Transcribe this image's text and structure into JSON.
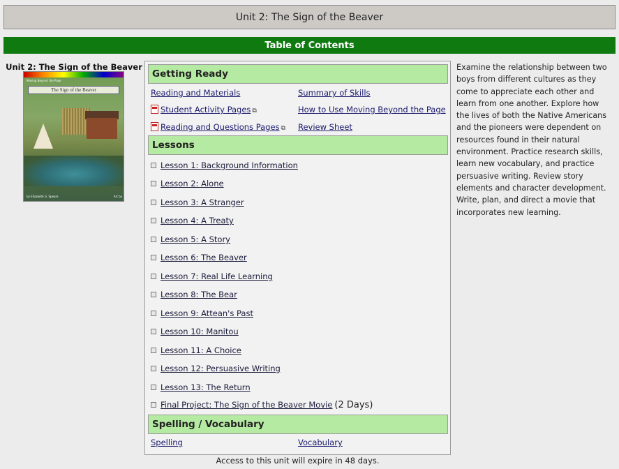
{
  "header": {
    "unit_title": "Unit 2: The Sign of the Beaver"
  },
  "toc": {
    "title": "Table of Contents"
  },
  "sidebar": {
    "title": "Unit 2: The Sign of the Beaver",
    "cover": {
      "top_left": "Moving Beyond the Page",
      "top_right": "Language Arts",
      "title": "The Sign of the Beaver",
      "bottom_left": "by Elizabeth G. Speare",
      "bottom_right": "Art by"
    }
  },
  "getting_ready": {
    "heading": "Getting Ready",
    "links": {
      "reading_materials": "Reading and Materials",
      "summary_skills": "Summary of Skills",
      "student_activity": "Student Activity Pages",
      "how_to_use": "How to Use Moving Beyond the Page",
      "reading_questions": "Reading and Questions Pages",
      "review_sheet": "Review Sheet"
    }
  },
  "lessons": {
    "heading": "Lessons",
    "items": [
      "Lesson 1: Background Information",
      "Lesson 2: Alone",
      "Lesson 3: A Stranger",
      "Lesson 4: A Treaty",
      "Lesson 5: A Story",
      "Lesson 6: The Beaver",
      "Lesson 7: Real Life Learning",
      "Lesson 8: The Bear",
      "Lesson 9: Attean's Past",
      "Lesson 10: Manitou",
      "Lesson 11: A Choice",
      "Lesson 12: Persuasive Writing",
      "Lesson 13: The Return",
      "Final Project: The Sign of the Beaver Movie"
    ],
    "final_extra": "(2 Days)"
  },
  "spelling": {
    "heading": "Spelling / Vocabulary",
    "spelling": "Spelling",
    "vocabulary": "Vocabulary"
  },
  "description": "Examine the relationship between two boys from different cultures as they come to appreciate each other and learn from one another. Explore how the lives of both the Native Americans and the pioneers were dependent on resources found in their natural environment. Practice research skills, learn new vocabulary, and practice persuasive writing. Review story elements and character development. Write, plan, and direct a movie that incorporates new learning.",
  "footer": {
    "expire": "Access to this unit will expire in 48 days."
  }
}
